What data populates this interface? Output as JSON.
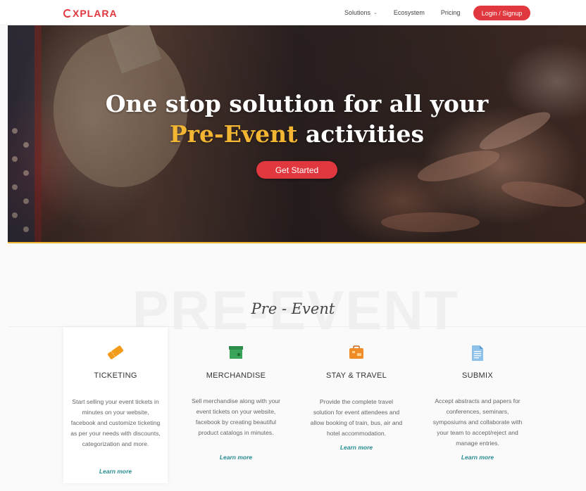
{
  "brand": {
    "logo_text": "XPLARA",
    "logo_mark": "e"
  },
  "nav": {
    "items": [
      {
        "label": "Solutions",
        "has_dropdown": true
      },
      {
        "label": "Ecosystem"
      },
      {
        "label": "Pricing"
      }
    ],
    "login_label": "Login / Signup"
  },
  "hero": {
    "line1": "One stop solution for all your",
    "line2_highlight": "Pre-Event",
    "line2_rest": "activities",
    "cta_label": "Get Started"
  },
  "section": {
    "background_word": "PRE-EVENT",
    "title": "Pre - Event"
  },
  "cards": [
    {
      "icon": "ticket-icon",
      "title": "TICKETING",
      "description": "Start selling your event tickets in minutes on your website, facebook and customize ticketing as per your needs with discounts, categorization and more.",
      "link": "Learn more"
    },
    {
      "icon": "merchandise-box-icon",
      "title": "MERCHANDISE",
      "description": "Sell merchandise along with your event tickets on your website, facebook by creating beautiful product catalogs in minutes.",
      "link": "Learn more"
    },
    {
      "icon": "suitcase-icon",
      "title": "STAY & TRAVEL",
      "description": "Provide the complete travel solution for event attendees and allow booking of train, bus, air and hotel accommodation.",
      "link": "Learn more"
    },
    {
      "icon": "document-icon",
      "title": "SUBMIX",
      "description": "Accept abstracts and papers for conferences, seminars, symposiums and collaborate with your team to accept/reject and manage entries.",
      "link": "Learn more"
    }
  ],
  "colors": {
    "brand_red": "#e0383e",
    "highlight_yellow": "#f2b632",
    "link_teal": "#2a8d95"
  }
}
